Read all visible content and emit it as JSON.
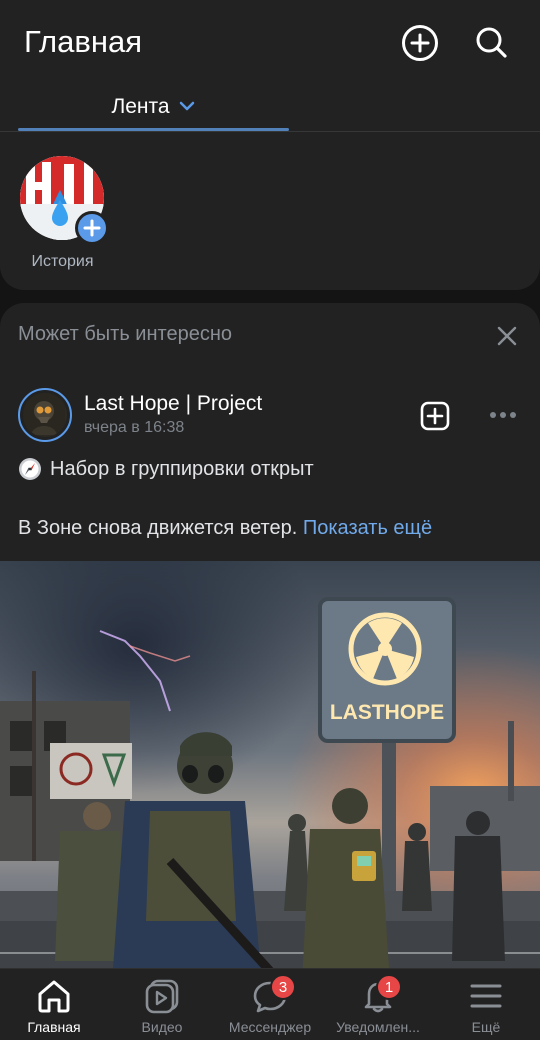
{
  "header": {
    "title": "Главная",
    "tab_label": "Лента"
  },
  "stories": {
    "label": "История"
  },
  "feed_card": {
    "heading": "Может быть интересно",
    "post": {
      "author": "Last Hope | Project",
      "time": "вчера в 16:38",
      "line1": "Набор в группировки открыт",
      "line2": "В Зоне снова движется ветер.",
      "show_more": "Показать ещё",
      "image_sign_text": "LASTHOPE"
    }
  },
  "bottom_nav": {
    "items": [
      {
        "label": "Главная",
        "icon": "home-icon",
        "active": true
      },
      {
        "label": "Видео",
        "icon": "video-icon"
      },
      {
        "label": "Мессенджер",
        "icon": "messenger-icon",
        "badge": "3"
      },
      {
        "label": "Уведомлен...",
        "icon": "bell-icon",
        "badge": "1"
      },
      {
        "label": "Ещё",
        "icon": "menu-icon"
      }
    ]
  },
  "colors": {
    "accent": "#5181b8",
    "link": "#71aaeb",
    "badge": "#e64646",
    "surface": "#222222",
    "background": "#141414"
  }
}
